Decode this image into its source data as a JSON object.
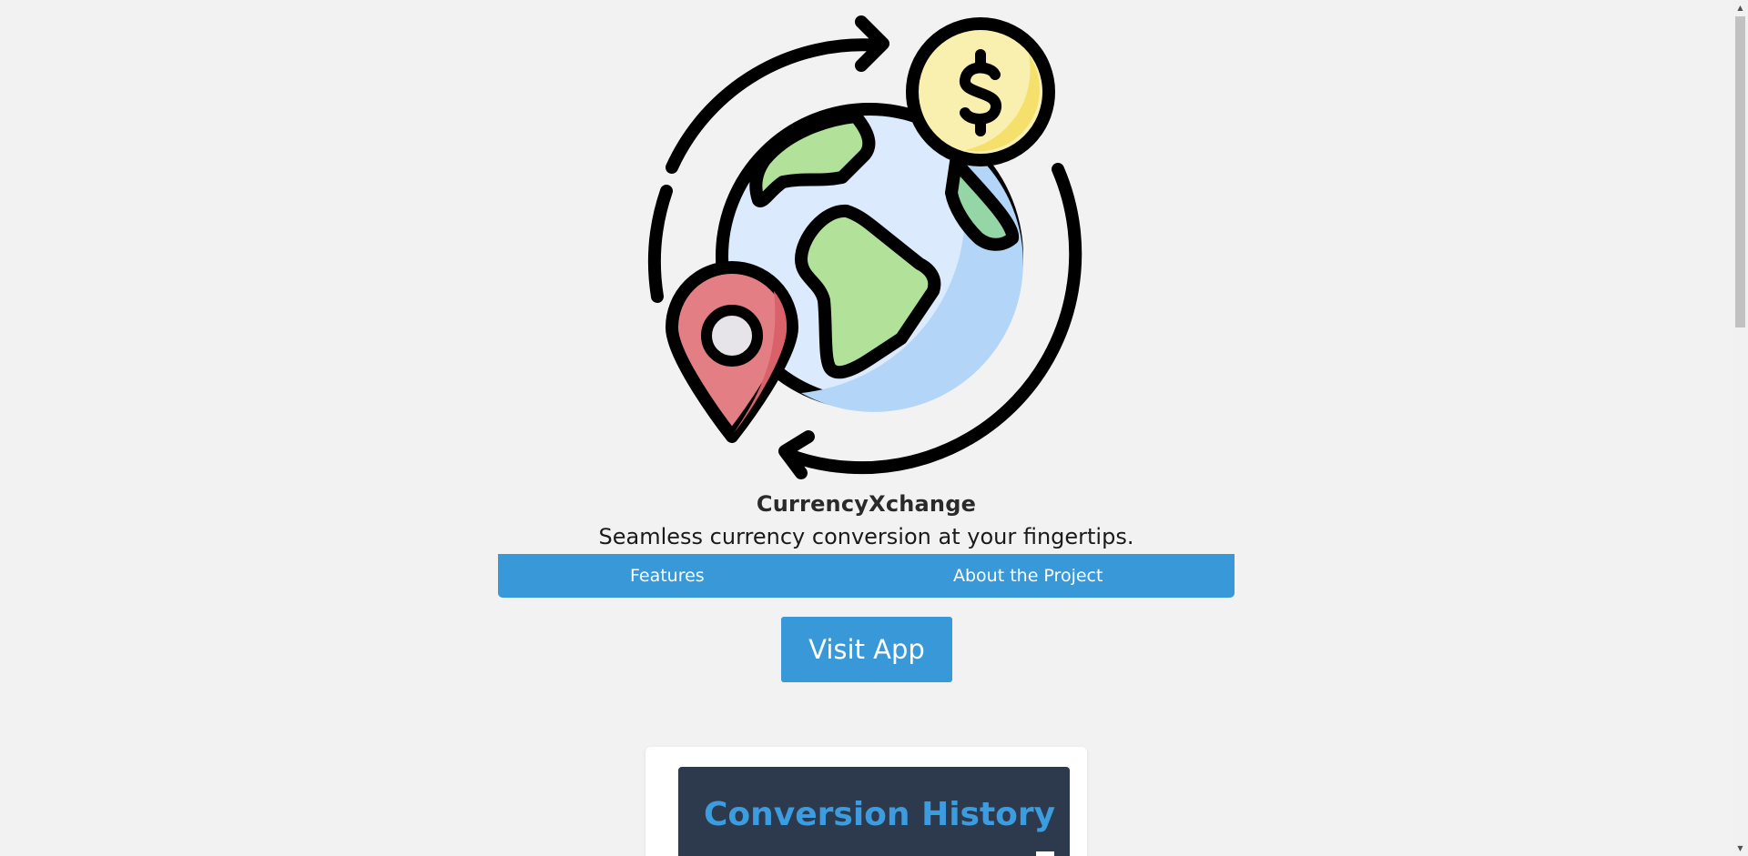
{
  "app": {
    "title": "CurrencyXchange",
    "tagline": "Seamless currency conversion at your fingertips."
  },
  "logo": {
    "icon": "globe-currency-exchange-icon",
    "colors": {
      "outline": "#000000",
      "globe": "#dbeafc",
      "globe_shade": "#b3d6f8",
      "land": "#b2e29a",
      "land_shade": "#94d6a6",
      "coin": "#f9efae",
      "coin_shade": "#f5e06c",
      "pin": "#e27e84",
      "pin_shade": "#d9616a",
      "pin_center": "#e6e4e8"
    }
  },
  "nav": {
    "items": [
      {
        "label": "Features"
      },
      {
        "label": "About the Project"
      }
    ]
  },
  "cta": {
    "label": "Visit App"
  },
  "preview_card": {
    "heading": "Conversion History"
  },
  "colors": {
    "page_background": "#f2f2f2",
    "accent": "#3999d8",
    "card_dark": "#2d3a4e",
    "card_heading": "#3b9de0"
  },
  "scrollbar": {
    "up_icon": "triangle-up-icon",
    "down_icon": "triangle-down-icon"
  }
}
